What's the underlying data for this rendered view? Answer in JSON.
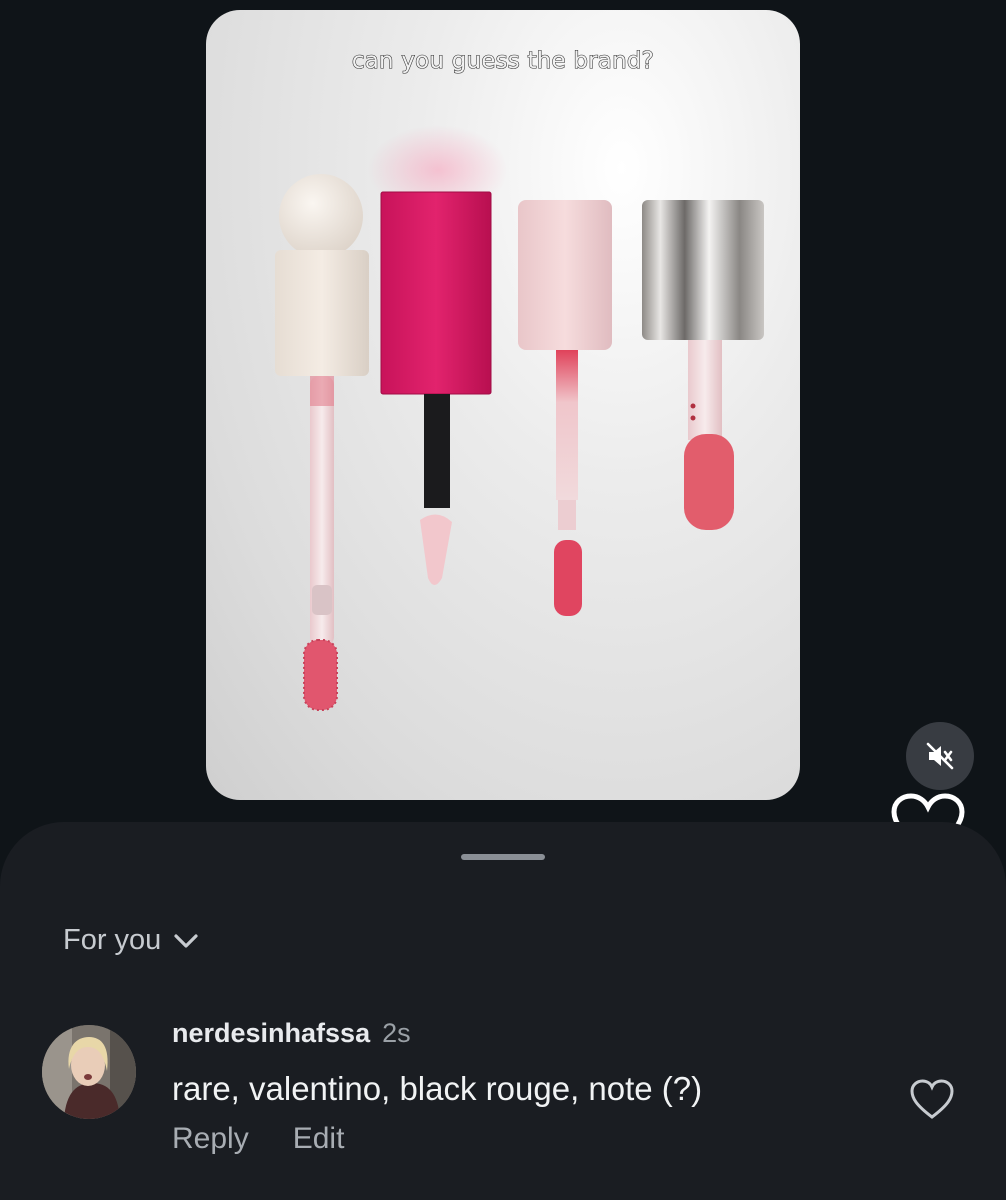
{
  "video": {
    "caption": "can you guess the brand?"
  },
  "controls": {
    "mute_icon": "speaker-muted-icon",
    "heart_icon": "heart-outline-icon"
  },
  "comments_sheet": {
    "filter_label": "For you",
    "filter_icon": "chevron-down-icon",
    "comments": [
      {
        "username": "nerdesinhafssa",
        "time": "2s",
        "text": "rare, valentino, black rouge, note (?)",
        "reply_label": "Reply",
        "edit_label": "Edit",
        "like_icon": "heart-outline-icon"
      }
    ]
  },
  "colors": {
    "background": "#0f1418",
    "sheet": "#1a1d22",
    "accent_pink": "#d81b60"
  }
}
